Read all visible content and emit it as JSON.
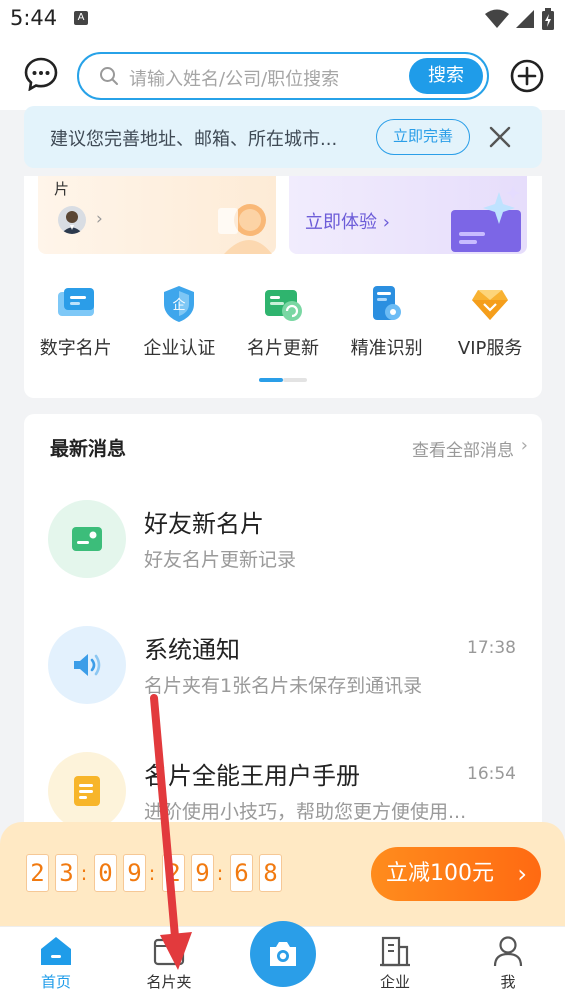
{
  "status_bar": {
    "time": "5:44",
    "notification_badge": "A"
  },
  "top_bar": {
    "search_placeholder": "请输入姓名/公司/职位搜索",
    "search_button": "搜索"
  },
  "complete_banner": {
    "text": "建议您完善地址、邮箱、所在城市...",
    "button": "立即完善"
  },
  "promos": {
    "left_text": "片",
    "right_text": "立即体验"
  },
  "features": [
    {
      "label": "数字名片",
      "icon": "digital-card-icon"
    },
    {
      "label": "企业认证",
      "icon": "enterprise-shield-icon"
    },
    {
      "label": "名片更新",
      "icon": "card-refresh-icon"
    },
    {
      "label": "精准识别",
      "icon": "precise-scan-icon"
    },
    {
      "label": "VIP服务",
      "icon": "vip-diamond-icon"
    }
  ],
  "messages": {
    "title": "最新消息",
    "view_all": "查看全部消息",
    "items": [
      {
        "name": "好友新名片",
        "subtitle": "好友名片更新记录",
        "time": ""
      },
      {
        "name": "系统通知",
        "subtitle": "名片夹有1张名片未保存到通讯录",
        "time": "17:38"
      },
      {
        "name": "名片全能王用户手册",
        "subtitle": "进阶使用小技巧，帮助您更方便使用...",
        "time": "16:54"
      }
    ]
  },
  "countdown": {
    "d1": "2",
    "d2": "3",
    "d3": "0",
    "d4": "9",
    "d5": "2",
    "d6": "9",
    "d7": "6",
    "d8": "8",
    "colon": ":",
    "button": "立减100元"
  },
  "bottom_nav": {
    "home": "首页",
    "cards": "名片夹",
    "enterprise": "企业",
    "me": "我"
  },
  "colors": {
    "accent": "#1f9ce9",
    "orange": "#ff7a12",
    "annotation_arrow": "#e8383b"
  }
}
